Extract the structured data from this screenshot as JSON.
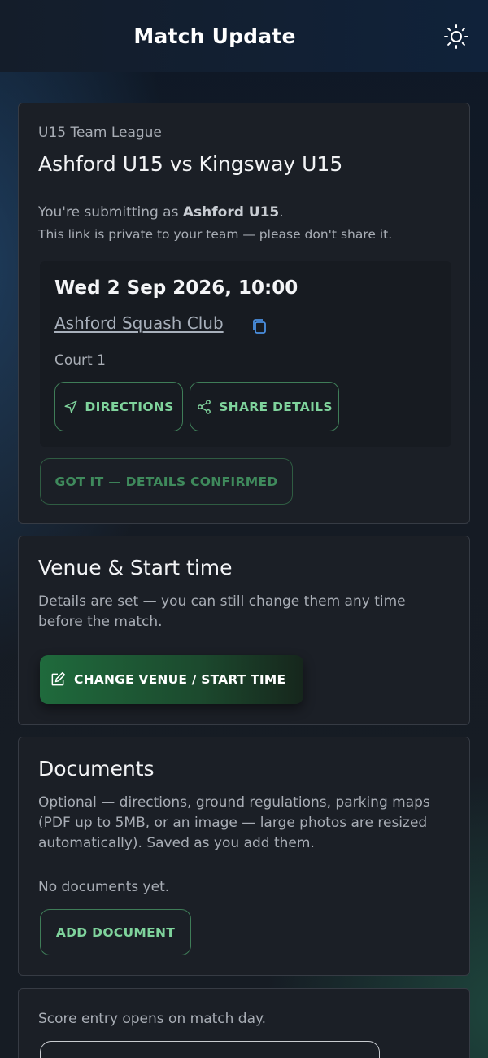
{
  "header": {
    "title": "Match Update",
    "theme_icon": "sun-icon"
  },
  "match": {
    "league": "U15 Team League",
    "title": "Ashford U15 vs Kingsway U15",
    "submitting_prefix": "You're submitting as ",
    "team": "Ashford U15",
    "submitting_suffix": ".",
    "private_note": "This link is private to your team — please don't share it.",
    "datetime": "Wed 2 Sep 2026, 10:00",
    "venue": "Ashford Squash Club",
    "court": "Court 1",
    "directions_label": "DIRECTIONS",
    "share_label": "SHARE DETAILS",
    "confirm_label": "GOT IT — DETAILS CONFIRMED"
  },
  "venue_section": {
    "title": "Venue & Start time",
    "description": "Details are set — you can still change them any time before the match.",
    "button_label": "CHANGE VENUE / START TIME"
  },
  "documents": {
    "title": "Documents",
    "description": "Optional — directions, ground regulations, parking maps (PDF up to 5MB, or an image — large photos are resized automatically). Saved as you add them.",
    "empty_text": "No documents yet.",
    "add_label": "ADD DOCUMENT"
  },
  "score": {
    "note": "Score entry opens on match day."
  },
  "colors": {
    "accent": "#7fd39c",
    "primary_button": "#1f6a3c",
    "card_bg": "#1b1f26"
  }
}
